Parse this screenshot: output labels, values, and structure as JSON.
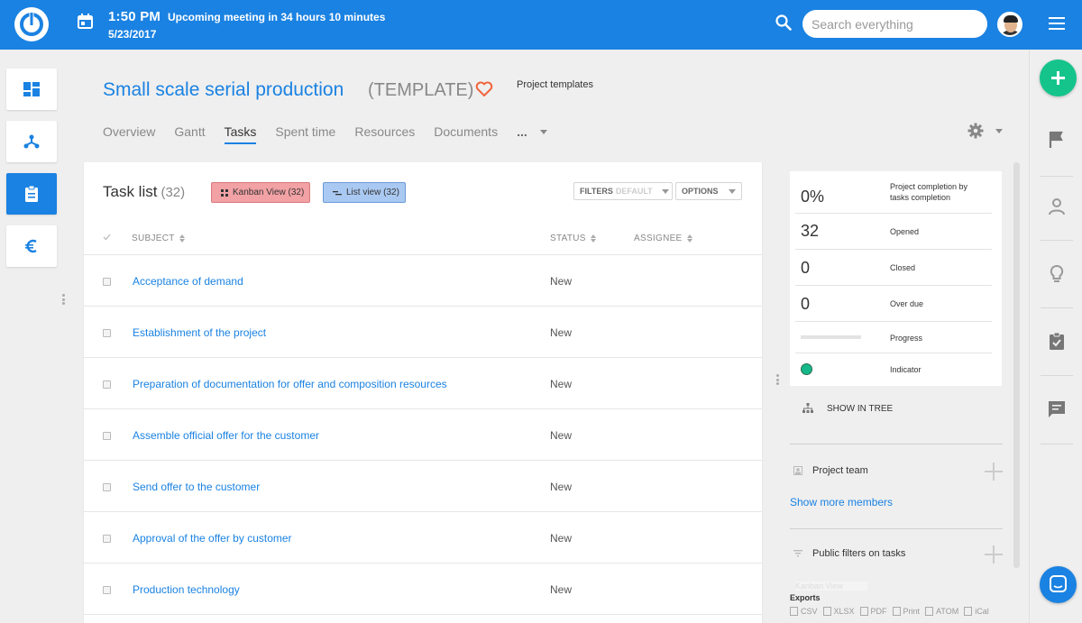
{
  "topbar": {
    "time": "1:50 PM",
    "meeting": "Upcoming meeting in 34 hours 10 minutes",
    "date": "5/23/2017",
    "search_placeholder": "Search everything"
  },
  "project": {
    "title": "Small scale serial production",
    "template_tag": "(TEMPLATE)",
    "breadcrumb_link": "Project templates"
  },
  "tabs": [
    "Overview",
    "Gantt",
    "Tasks",
    "Spent time",
    "Resources",
    "Documents"
  ],
  "tabs_more": "...",
  "task_list": {
    "title": "Task list",
    "count": "(32)",
    "kanban_btn": "Kanban View (32)",
    "list_btn": "List view (32)",
    "filters_label": "FILTERS",
    "filters_value": "DEFAULT",
    "options_label": "OPTIONS",
    "columns": {
      "subject": "SUBJECT",
      "status": "STATUS",
      "assignee": "ASSIGNEE"
    },
    "rows": [
      {
        "subject": "Acceptance of demand",
        "status": "New"
      },
      {
        "subject": "Establishment of the project",
        "status": "New"
      },
      {
        "subject": "Preparation of documentation for offer and composition resources",
        "status": "New"
      },
      {
        "subject": "Assemble official offer for the customer",
        "status": "New"
      },
      {
        "subject": "Send offer to the customer",
        "status": "New"
      },
      {
        "subject": "Approval of the offer by customer",
        "status": "New"
      },
      {
        "subject": "Production technology",
        "status": "New"
      }
    ]
  },
  "stats": {
    "completion_value": "0%",
    "completion_label": "Project completion by tasks completion",
    "opened_value": "32",
    "opened_label": "Opened",
    "closed_value": "0",
    "closed_label": "Closed",
    "overdue_value": "0",
    "overdue_label": "Over due",
    "progress_label": "Progress",
    "progress_fraction": 0.0,
    "indicator_label": "Indicator",
    "indicator_color": "#16b88a"
  },
  "sidepanel": {
    "show_in_tree": "SHOW IN TREE",
    "project_team": "Project team",
    "show_more_members": "Show more members",
    "public_filters": "Public filters on tasks",
    "ghost_item": "Kanban View",
    "exports_title": "Exports",
    "exports": [
      "CSV",
      "XLSX",
      "PDF",
      "Print",
      "ATOM",
      "iCal"
    ]
  },
  "colors": {
    "brand": "#1a82e2",
    "fab": "#14c48b",
    "kanban_btn": "#f2a1a4",
    "list_btn": "#aac9f2"
  }
}
